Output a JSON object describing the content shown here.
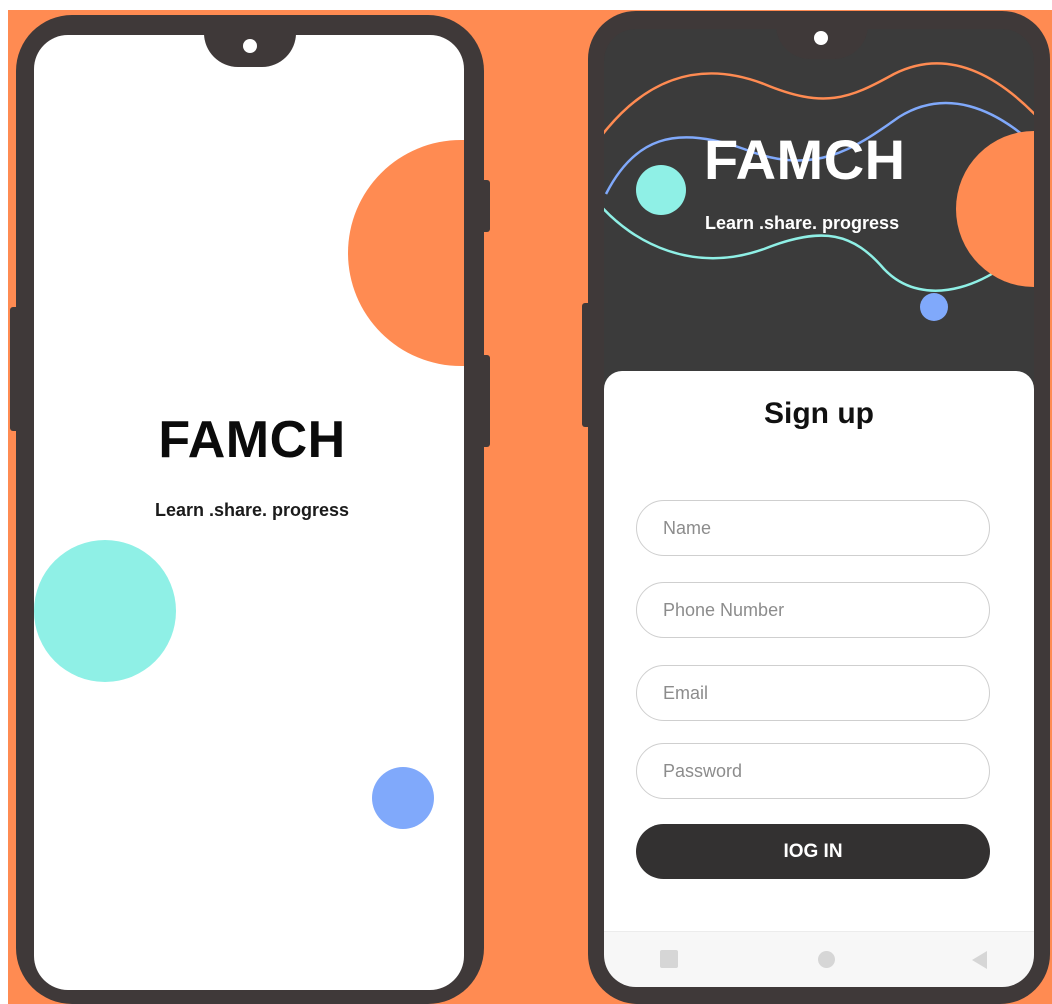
{
  "splash": {
    "app_name": "FAMCH",
    "tagline": "Learn .share. progress"
  },
  "signup": {
    "app_name": "FAMCH",
    "tagline": "Learn .share. progress",
    "form_title": "Sign up",
    "fields": {
      "name_placeholder": "Name",
      "phone_placeholder": "Phone Number",
      "email_placeholder": "Email",
      "password_placeholder": "Password"
    },
    "submit_label": "IOG IN"
  },
  "colors": {
    "background": "#ff8b52",
    "phone_frame": "#3f3939",
    "accent_orange": "#ff8b52",
    "accent_mint": "#8ff0e6",
    "accent_blue": "#80a9fb",
    "header_dark": "#3b3b3b",
    "button_dark": "#333131"
  },
  "icons": {
    "nav_recent": "square-icon",
    "nav_home": "circle-icon",
    "nav_back": "triangle-back-icon"
  }
}
